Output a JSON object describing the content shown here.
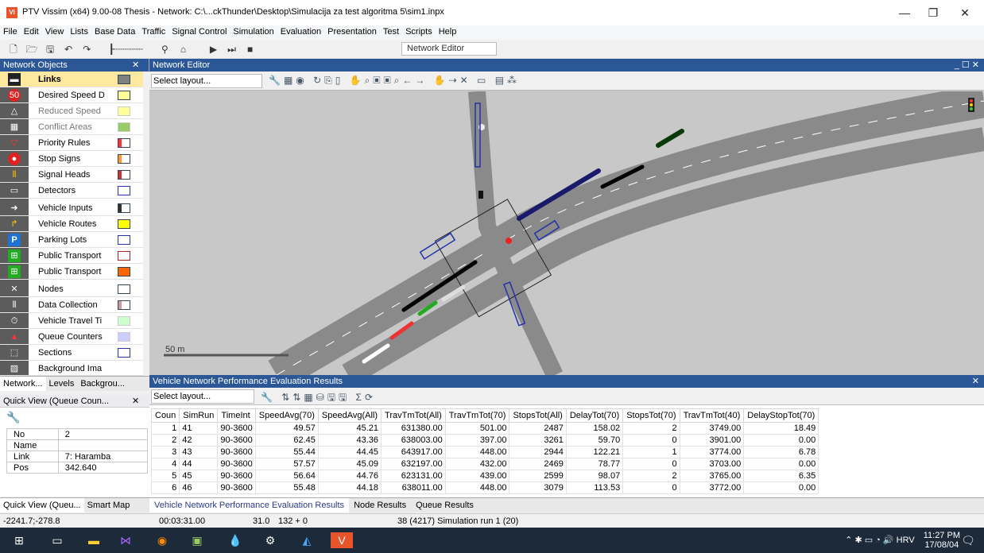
{
  "window": {
    "title": "PTV Vissim (x64) 9.00-08 Thesis - Network: C:\\...ckThunder\\Desktop\\Simulacija za test algoritma 5\\sim1.inpx",
    "minimize": "—",
    "restore": "❐",
    "close": "✕"
  },
  "menu": [
    "File",
    "Edit",
    "View",
    "Lists",
    "Base Data",
    "Traffic",
    "Signal Control",
    "Simulation",
    "Evaluation",
    "Presentation",
    "Test",
    "Scripts",
    "Help"
  ],
  "toolbar": {
    "combo": "Network Editor"
  },
  "network_objects": {
    "title": "Network Objects",
    "items": [
      {
        "label": "Links",
        "color": "#808080"
      },
      {
        "label": "Desired Speed D",
        "color": "#ffff99"
      },
      {
        "label": "Reduced Speed",
        "color": "#ffff99"
      },
      {
        "label": "Conflict Areas",
        "color": "#99cc66"
      },
      {
        "label": "Priority Rules",
        "color": "#ff3333"
      },
      {
        "label": "Stop Signs",
        "color": "#ff9933"
      },
      {
        "label": "Signal Heads",
        "color": "#cc3333"
      },
      {
        "label": "Detectors",
        "color": "#ffffff"
      },
      {
        "label": "Vehicle Inputs",
        "color": "#333333"
      },
      {
        "label": "Vehicle Routes",
        "color": "#ffff00"
      },
      {
        "label": "Parking Lots",
        "color": "#ffffff"
      },
      {
        "label": "Public Transport",
        "color": "#ffffff"
      },
      {
        "label": "Public Transport",
        "color": "#ff6600"
      },
      {
        "label": "Nodes",
        "color": "#ffffff"
      },
      {
        "label": "Data Collection",
        "color": "#cc9999"
      },
      {
        "label": "Vehicle Travel Ti",
        "color": "#ccffcc"
      },
      {
        "label": "Queue Counters",
        "color": "#ccccff"
      },
      {
        "label": "Sections",
        "color": "#ffffff"
      },
      {
        "label": "Background Ima",
        "color": "#ffffff"
      }
    ],
    "tabs": [
      "Network...",
      "Levels",
      "Backgrou..."
    ]
  },
  "quick_view": {
    "title": "Quick View (Queue Coun...",
    "rows": [
      [
        "No",
        "2"
      ],
      [
        "Name",
        ""
      ],
      [
        "Link",
        "7: Haramba"
      ],
      [
        "Pos",
        "342.640"
      ]
    ],
    "tabs": [
      "Quick View (Queu...",
      "Smart Map"
    ]
  },
  "editor": {
    "title": "Network Editor",
    "layout": "Select layout...",
    "scale_label": "50 m"
  },
  "results": {
    "title": "Vehicle Network Performance Evaluation Results",
    "layout": "Select layout...",
    "columns": [
      "Coun",
      "SimRun",
      "TimeInt",
      "SpeedAvg(70)",
      "SpeedAvg(All)",
      "TravTmTot(All)",
      "TravTmTot(70)",
      "StopsTot(All)",
      "DelayTot(70)",
      "StopsTot(70)",
      "TravTmTot(40)",
      "DelayStopTot(70)"
    ],
    "rows": [
      [
        "1",
        "41",
        "90-3600",
        "49.57",
        "45.21",
        "631380.00",
        "501.00",
        "2487",
        "158.02",
        "2",
        "3749.00",
        "18.49"
      ],
      [
        "2",
        "42",
        "90-3600",
        "62.45",
        "43.36",
        "638003.00",
        "397.00",
        "3261",
        "59.70",
        "0",
        "3901.00",
        "0.00"
      ],
      [
        "3",
        "43",
        "90-3600",
        "55.44",
        "44.45",
        "643917.00",
        "448.00",
        "2944",
        "122.21",
        "1",
        "3774.00",
        "6.78"
      ],
      [
        "4",
        "44",
        "90-3600",
        "57.57",
        "45.09",
        "632197.00",
        "432.00",
        "2469",
        "78.77",
        "0",
        "3703.00",
        "0.00"
      ],
      [
        "5",
        "45",
        "90-3600",
        "56.64",
        "44.76",
        "623131.00",
        "439.00",
        "2599",
        "98.07",
        "2",
        "3765.00",
        "6.35"
      ],
      [
        "6",
        "46",
        "90-3600",
        "55.48",
        "44.18",
        "638011.00",
        "448.00",
        "3079",
        "113.53",
        "0",
        "3772.00",
        "0.00"
      ]
    ],
    "tabs": [
      "Vehicle Network Performance Evaluation Results",
      "Node Results",
      "Queue Results"
    ]
  },
  "status": {
    "coords": "-2241.7;-278.8",
    "time": "00:03:31.00",
    "speed": "31.0",
    "counter": "132 + 0",
    "run": "38 (4217) Simulation run 1 (20)"
  },
  "tray": {
    "lang": "HRV",
    "time": "11:27 PM",
    "date": "17/08/04"
  }
}
